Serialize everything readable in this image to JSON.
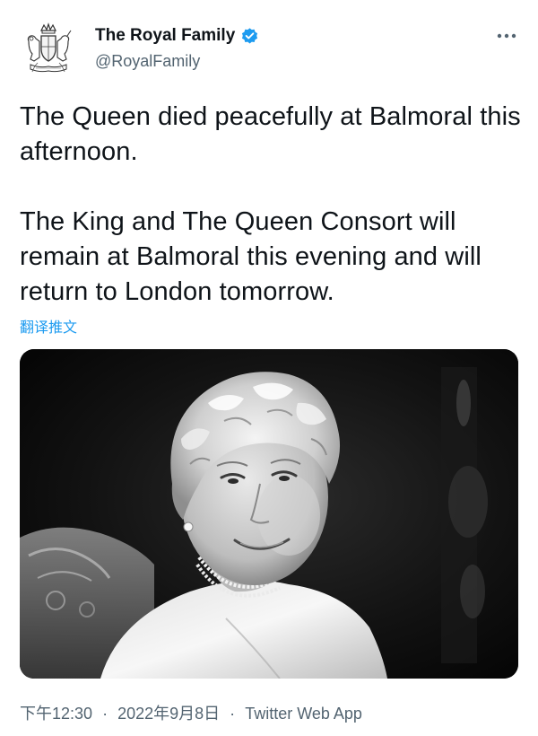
{
  "author": {
    "display_name": "The Royal Family",
    "handle": "@RoyalFamily",
    "verified": true,
    "avatar_icon": "royal-coat-of-arms-icon"
  },
  "tweet": {
    "paragraph_1": "The Queen died peacefully at Balmoral this afternoon.",
    "paragraph_2": "The King and The Queen Consort will remain at Balmoral this evening and will return to London tomorrow.",
    "translate_label": "翻译推文"
  },
  "media": {
    "type": "black-and-white portrait photograph"
  },
  "meta": {
    "time": "下午12:30",
    "date": "2022年9月8日",
    "separator": "·",
    "source": "Twitter Web App"
  },
  "icons": {
    "verified": "verified-badge-icon",
    "more": "more-options-icon"
  },
  "colors": {
    "text": "#0f1419",
    "secondary": "#536471",
    "link": "#1d9bf0",
    "verified": "#1d9bf0"
  }
}
